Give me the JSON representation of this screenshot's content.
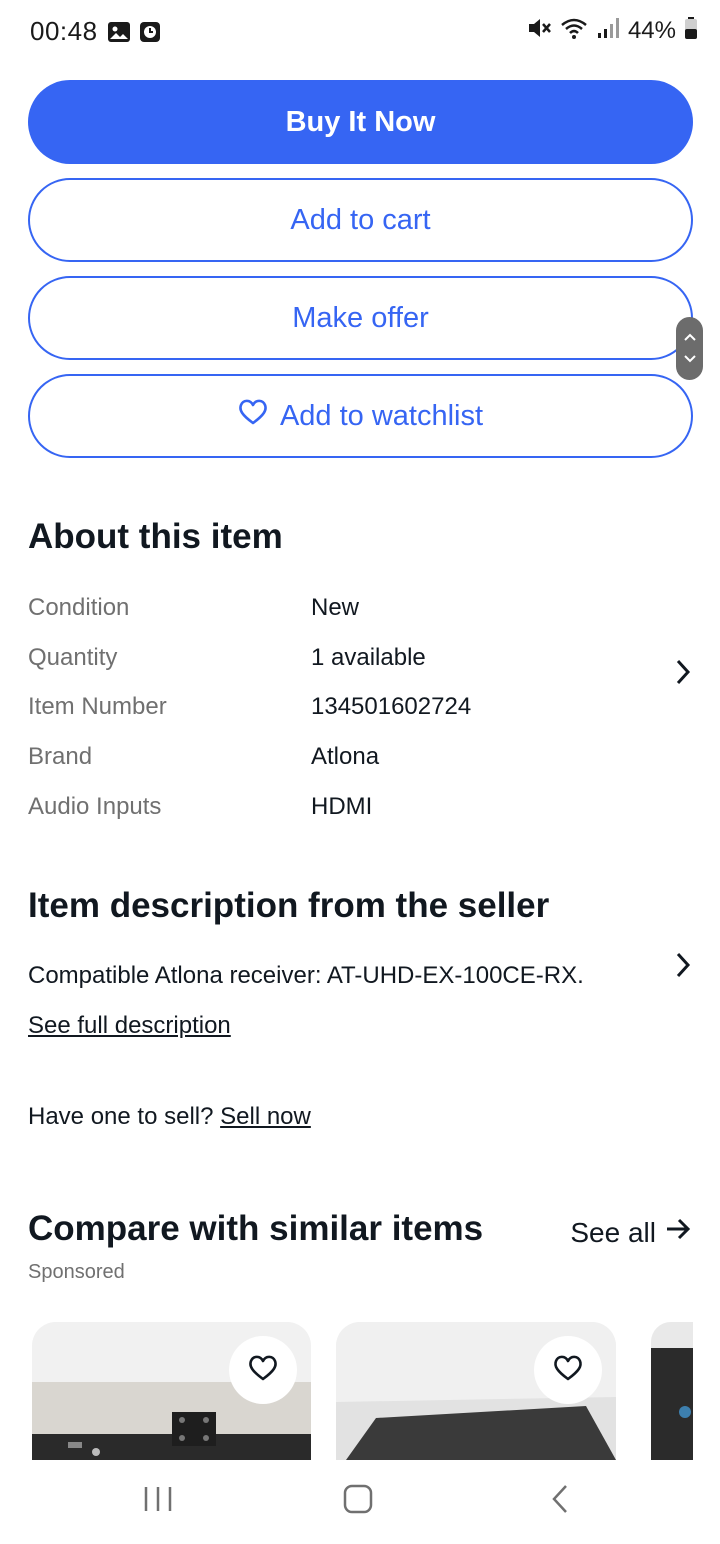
{
  "status_bar": {
    "time": "00:48",
    "battery": "44%",
    "icons": [
      "gallery-icon",
      "clock-icon",
      "mute-icon",
      "wifi-icon",
      "signal-icon",
      "battery-icon"
    ]
  },
  "buttons": {
    "buy_now": "Buy It Now",
    "add_to_cart": "Add to cart",
    "make_offer": "Make offer",
    "add_to_watchlist": "Add to watchlist"
  },
  "about": {
    "title": "About this item",
    "rows": [
      {
        "label": "Condition",
        "value": "New"
      },
      {
        "label": "Quantity",
        "value": "1 available"
      },
      {
        "label": "Item Number",
        "value": "134501602724"
      },
      {
        "label": "Brand",
        "value": "Atlona"
      },
      {
        "label": "Audio Inputs",
        "value": "HDMI"
      }
    ]
  },
  "description": {
    "title": "Item description from the seller",
    "text": "Compatible Atlona receiver: AT-UHD-EX-100CE-RX.",
    "see_full": "See full description"
  },
  "sell": {
    "prompt": "Have one to sell?",
    "link": "Sell now"
  },
  "compare": {
    "title": "Compare with similar items",
    "see_all": "See all",
    "sponsored": "Sponsored"
  },
  "colors": {
    "accent": "#3665f3",
    "text": "#111820",
    "muted": "#707070"
  }
}
